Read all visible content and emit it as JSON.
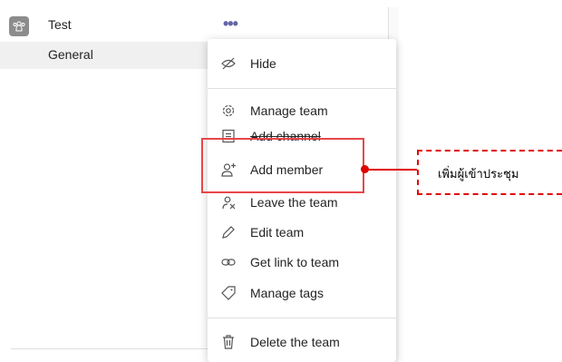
{
  "team": {
    "name": "Test",
    "more_label": "•••",
    "channel": "General"
  },
  "menu": {
    "items": [
      {
        "label": "Hide",
        "icon": "hide-icon"
      },
      {
        "label": "Manage team",
        "icon": "gear-icon"
      },
      {
        "label": "Add channel",
        "icon": "channel-list-icon"
      },
      {
        "label": "Add member",
        "icon": "add-person-icon"
      },
      {
        "label": "Leave the team",
        "icon": "leave-icon"
      },
      {
        "label": "Edit team",
        "icon": "pencil-icon"
      },
      {
        "label": "Get link to team",
        "icon": "link-icon"
      },
      {
        "label": "Manage tags",
        "icon": "tag-icon"
      },
      {
        "label": "Delete the team",
        "icon": "trash-icon"
      }
    ]
  },
  "annotation": {
    "text": "เพิ่มผู้เข้าประชุม",
    "color": "#e00000"
  },
  "colors": {
    "accent": "#6264a7",
    "highlight": "#e8464c"
  }
}
